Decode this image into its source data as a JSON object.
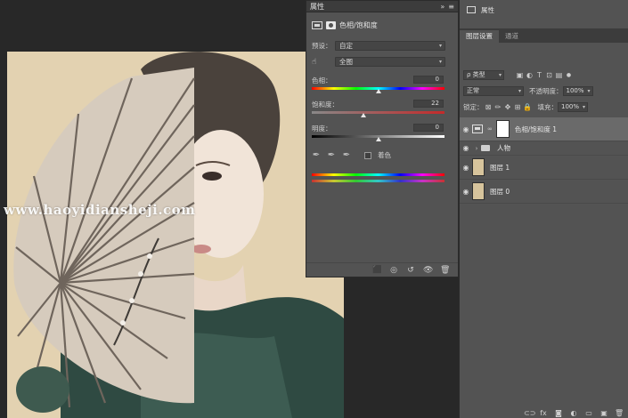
{
  "watermark": "www.haoyidiansheji.com",
  "properties": {
    "title": "属性",
    "collapse_glyph": "»",
    "menu_glyph": "≡",
    "adjustment_name": "色相/饱和度",
    "preset_label": "预设：",
    "preset_value": "自定",
    "channel_value": "全图",
    "hue_label": "色相：",
    "hue_value": "0",
    "saturation_label": "饱和度：",
    "saturation_value": "22",
    "lightness_label": "明度：",
    "lightness_value": "0",
    "colorize_label": "着色",
    "hand_glyph": "☝",
    "eyedropper_glyph": "✒",
    "footer_icons": [
      "⬛",
      "◎",
      "↺",
      "👁",
      "🗑"
    ]
  },
  "dock": {
    "properties_item": "属性",
    "tabs": [
      {
        "label": "图层设置",
        "active": true
      },
      {
        "label": "通道",
        "active": false
      }
    ],
    "filter": {
      "kind_label": "ρ 类型",
      "icons": [
        "▣",
        "◐",
        "T",
        "⊡",
        "▤"
      ],
      "toggle_glyph": "●"
    },
    "blend": {
      "mode": "正常",
      "opacity_label": "不透明度：",
      "opacity_value": "100%"
    },
    "lock": {
      "label": "锁定：",
      "icons": [
        "⊠",
        "✏",
        "✥",
        "⊞",
        "🔒"
      ],
      "fill_label": "填充：",
      "fill_value": "100%"
    },
    "layers": [
      {
        "name": "色相/饱和度 1",
        "kind": "adjustment",
        "selected": true
      },
      {
        "name": "人物",
        "kind": "group",
        "selected": false
      },
      {
        "name": "图层 1",
        "kind": "image",
        "selected": false
      },
      {
        "name": "图层 0",
        "kind": "image",
        "selected": false
      }
    ],
    "bottom_icons": [
      "⊂⊃",
      "fx",
      "◙",
      "◐",
      "▭",
      "▣",
      "🗑"
    ]
  },
  "slider_levels": {
    "hue_fraction": 0.5,
    "saturation_fraction": 0.39,
    "lightness_fraction": 0.5
  }
}
